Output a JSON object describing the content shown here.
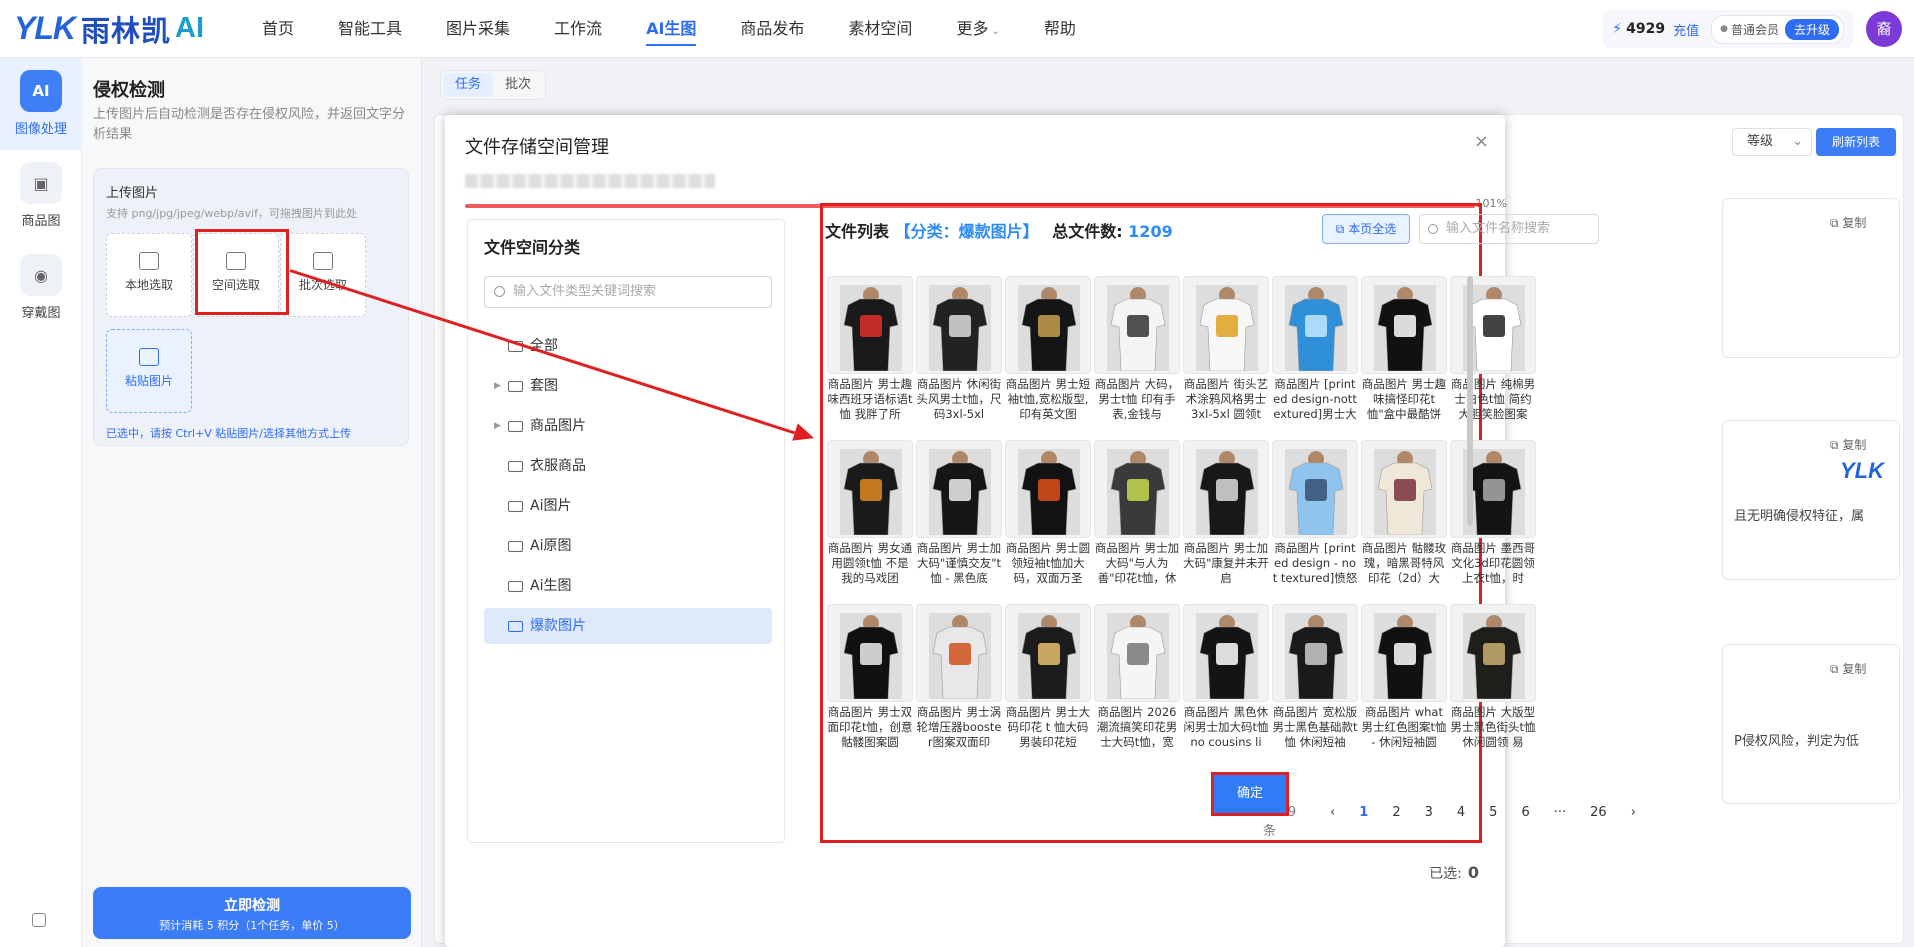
{
  "brand": {
    "logo_ylk": "YLK",
    "logo_cn": "雨林凯",
    "logo_ai": "AI"
  },
  "nav": {
    "items": [
      "首页",
      "智能工具",
      "图片采集",
      "工作流",
      "AI生图",
      "商品发布",
      "素材空间",
      "更多",
      "帮助"
    ],
    "active_index": 4
  },
  "account": {
    "credits": "4929",
    "recharge": "充值",
    "member": "普通会员",
    "upgrade": "去升级",
    "avatar": "裔"
  },
  "rail": {
    "items": [
      "图像处理",
      "商品图",
      "穿戴图"
    ],
    "active_icon": "AI"
  },
  "panel": {
    "title": "侵权检测",
    "desc": "上传图片后自动检测是否存在侵权风险，并返回文字分析结果",
    "upload_title": "上传图片",
    "upload_hint": "支持 png/jpg/jpeg/webp/avif，可拖拽图片到此处",
    "options": [
      "本地选取",
      "空间选取",
      "批次选取",
      "粘贴图片"
    ],
    "note": "已选中，请按 Ctrl+V 粘贴图片/选择其他方式上传",
    "detect_btn": "立即检测",
    "detect_sub": "预计消耗 5 积分（1个任务，单价 5）"
  },
  "main": {
    "tabs": [
      "任务",
      "批次"
    ],
    "level_select": "等级",
    "refresh": "刷新列表",
    "copy_label": "复制",
    "snippet_1": "且无明确侵权特征，属",
    "snippet_2": "P侵权风险，判定为低"
  },
  "modal": {
    "title": "文件存储空间管理",
    "progress_pct": "101%",
    "progress": 1.0,
    "cat_title": "文件空间分类",
    "cat_search_placeholder": "输入文件类型关键词搜索",
    "categories": [
      {
        "label": "全部",
        "expandable": false
      },
      {
        "label": "套图",
        "expandable": true
      },
      {
        "label": "商品图片",
        "expandable": true
      },
      {
        "label": "衣服商品",
        "expandable": false
      },
      {
        "label": "Ai图片",
        "expandable": false
      },
      {
        "label": "Ai原图",
        "expandable": false
      },
      {
        "label": "Ai生图",
        "expandable": false
      },
      {
        "label": "爆款图片",
        "expandable": false
      }
    ],
    "active_category": 7,
    "file_list_label": "文件列表",
    "file_category_tag": "【分类：爆款图片】",
    "total_label": "总文件数:",
    "total_files": "1209",
    "select_page": "本页全选",
    "file_search_placeholder": "输入文件名称搜索",
    "files": [
      {
        "caption": "商品图片 男士趣味西班牙语标语t恤 我胖了所",
        "shirt": "#1a1a1a",
        "print": "#e0302a"
      },
      {
        "caption": "商品图片 休闲街头风男士t恤，尺码3xl-5xl",
        "shirt": "#222222",
        "print": "#dddddd"
      },
      {
        "caption": "商品图片 男士短袖t恤,宽松版型,印有英文图",
        "shirt": "#151515",
        "print": "#c8a050"
      },
      {
        "caption": "商品图片 大码，男士t恤 印有手表,金钱与",
        "shirt": "#f4f4f4",
        "print": "#333333"
      },
      {
        "caption": "商品图片 街头艺术涂鸦风格男士3xl-5xl 圆领t",
        "shirt": "#f7f7f7",
        "print": "#e0a020"
      },
      {
        "caption": "商品图片 [print ed design-nottextured]男士大",
        "shirt": "#2f8fd8",
        "print": "#c4e8ff"
      },
      {
        "caption": "商品图片 男士趣味搞怪印花t恤\"盒中最酷饼",
        "shirt": "#111111",
        "print": "#ffffff"
      },
      {
        "caption": "商品图片 纯棉男士白色t恤 简约大胆笑脸图案",
        "shirt": "#ffffff",
        "print": "#222222"
      },
      {
        "caption": "商品图片 男女通用圆领t恤 不是我的马戏团",
        "shirt": "#1a1a1a",
        "print": "#e08a20"
      },
      {
        "caption": "商品图片 男士加大码\"谨慎交友\"t恤 - 黑色底",
        "shirt": "#161616",
        "print": "#eeeeee"
      },
      {
        "caption": "商品图片 男士圆领短袖t恤加大码，双面万圣",
        "shirt": "#121212",
        "print": "#e0501a"
      },
      {
        "caption": "商品图片 男士加大码\"与人为善\"印花t恤，休",
        "shirt": "#3a3a3a",
        "print": "#c8d850"
      },
      {
        "caption": "商品图片 男士加大码\"康复并未开启",
        "shirt": "#181818",
        "print": "#dddddd"
      },
      {
        "caption": "商品图片 [print ed design - not textured]愤怒大",
        "shirt": "#8fc4ee",
        "print": "#355070"
      },
      {
        "caption": "商品图片 骷髅玫瑰，暗黑哥特风印花（2d）大",
        "shirt": "#efe8d8",
        "print": "#7a3040"
      },
      {
        "caption": "商品图片 墨西哥文化3d印花圆领上衣t恤，时",
        "shirt": "#141414",
        "print": "#aaaaaa"
      },
      {
        "caption": "商品图片 男士双面印花t恤，创意骷髅图案圆",
        "shirt": "#101010",
        "print": "#eeeeee"
      },
      {
        "caption": "商品图片 男士涡轮增压器booster图案双面印",
        "shirt": "#e8e8e8",
        "print": "#d0501a"
      },
      {
        "caption": "商品图片 男士大码印花 t 恤大码男装印花短",
        "shirt": "#1c1c1c",
        "print": "#e8c070"
      },
      {
        "caption": "商品图片 2026潮流搞笑印花男士大码t恤，宽",
        "shirt": "#f5f5f5",
        "print": "#777777"
      },
      {
        "caption": "商品图片 黑色休闲男士加大码t恤 no cousins li",
        "shirt": "#141414",
        "print": "#ffffff"
      },
      {
        "caption": "商品图片 宽松版男士黑色基础款t恤 休闲短袖",
        "shirt": "#1a1a1a",
        "print": "#cccccc"
      },
      {
        "caption": "商品图片 what 男士红色图案t恤 - 休闲短袖圆",
        "shirt": "#111111",
        "print": "#ffffff"
      },
      {
        "caption": "商品图片 大版型男士黑色街头t恤 休闲圆领 易",
        "shirt": "#1e1e1a",
        "print": "#c8b070"
      }
    ],
    "pagination": {
      "total_text": "共 1209 条",
      "prev": "‹",
      "pages": [
        "1",
        "2",
        "3",
        "4",
        "5",
        "6",
        "···",
        "26"
      ],
      "current": "1",
      "next": "›"
    },
    "selected_label": "已选:",
    "selected_count": "0",
    "confirm": "确定",
    "close": "×"
  },
  "colors": {
    "accent": "#2f6bf3",
    "annotation_red": "#e02020"
  }
}
